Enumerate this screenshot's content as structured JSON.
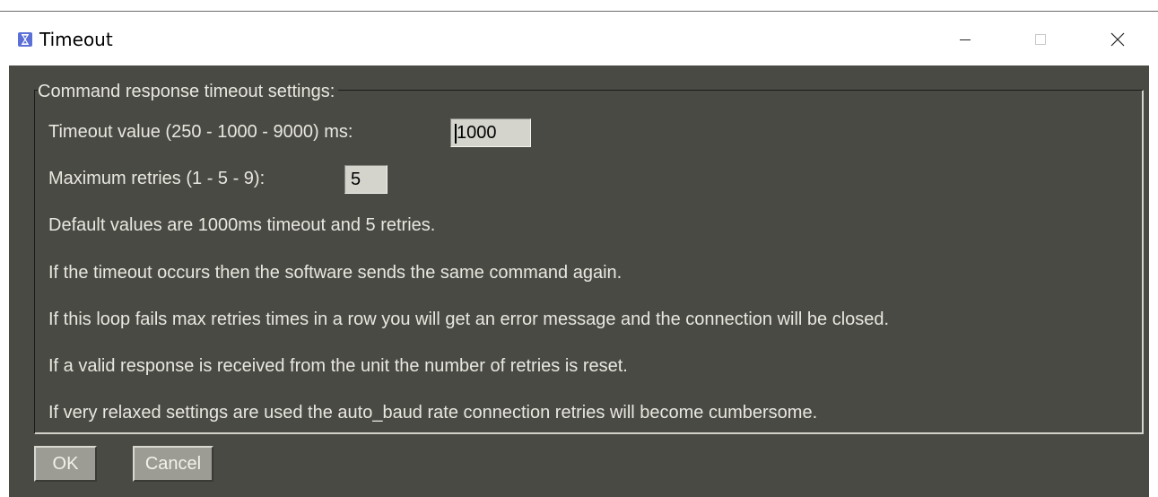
{
  "window": {
    "title": "Timeout",
    "icon": "hourglass-icon",
    "controls": [
      "minimize-icon",
      "maximize-icon",
      "close-icon"
    ]
  },
  "group": {
    "title": "Command response timeout settings:"
  },
  "timeout": {
    "label": "Timeout value (250 - 1000 - 9000) ms:",
    "value": "1000"
  },
  "retries": {
    "label": "Maximum retries (1 - 5 - 9):",
    "value": "5"
  },
  "info": [
    "Default values are 1000ms timeout and 5 retries.",
    "If the timeout occurs then the software sends the same command again.",
    "If this loop fails max retries times in a row you will get an error message and the connection will be closed.",
    "If a valid response is received from the unit the number of retries is reset.",
    "If very relaxed settings are used the auto_baud rate connection retries will become cumbersome."
  ],
  "buttons": {
    "ok": "OK",
    "cancel": "Cancel"
  },
  "colors": {
    "client_bg": "#4a4a44",
    "text": "#e8e8e0",
    "field_bg": "#d4d4cc",
    "button_bg": "#9c9c94",
    "app_icon": "#5b6fd6"
  }
}
